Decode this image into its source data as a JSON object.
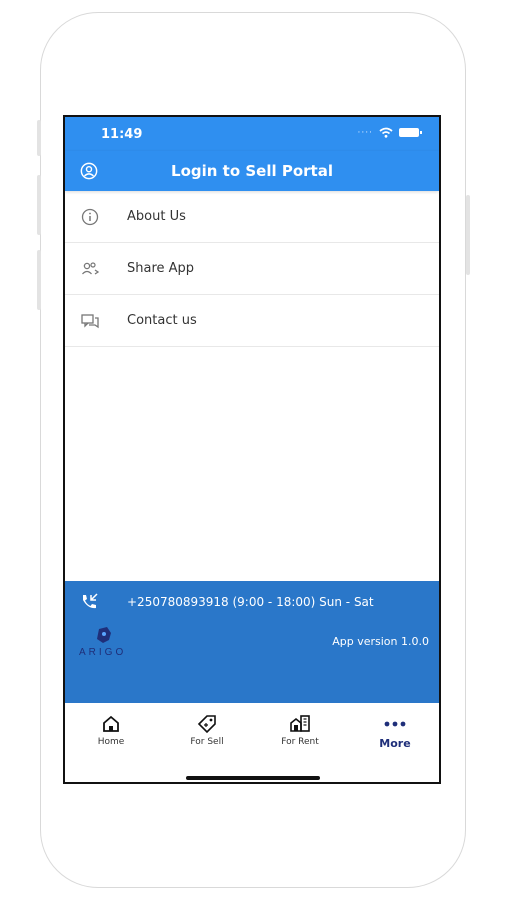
{
  "status_bar": {
    "time": "11:49"
  },
  "app_bar": {
    "title": "Login to Sell Portal"
  },
  "menu": {
    "items": [
      {
        "label": "About Us",
        "icon": "info-icon"
      },
      {
        "label": "Share App",
        "icon": "share-users-icon"
      },
      {
        "label": "Contact us",
        "icon": "chat-icon"
      }
    ]
  },
  "footer": {
    "phone": "+250780893918 (9:00 - 18:00) Sun - Sat",
    "version": "App version 1.0.0",
    "logo_text": "ARIGO"
  },
  "bottom_nav": {
    "items": [
      {
        "label": "Home",
        "icon": "home-icon"
      },
      {
        "label": "For Sell",
        "icon": "tag-icon"
      },
      {
        "label": "For Rent",
        "icon": "building-icon"
      },
      {
        "label": "More",
        "icon": "more-icon"
      }
    ],
    "active": "More"
  },
  "colors": {
    "primary": "#2f8ff0",
    "footer": "#2a77c9",
    "active_nav": "#1f2f7a"
  }
}
